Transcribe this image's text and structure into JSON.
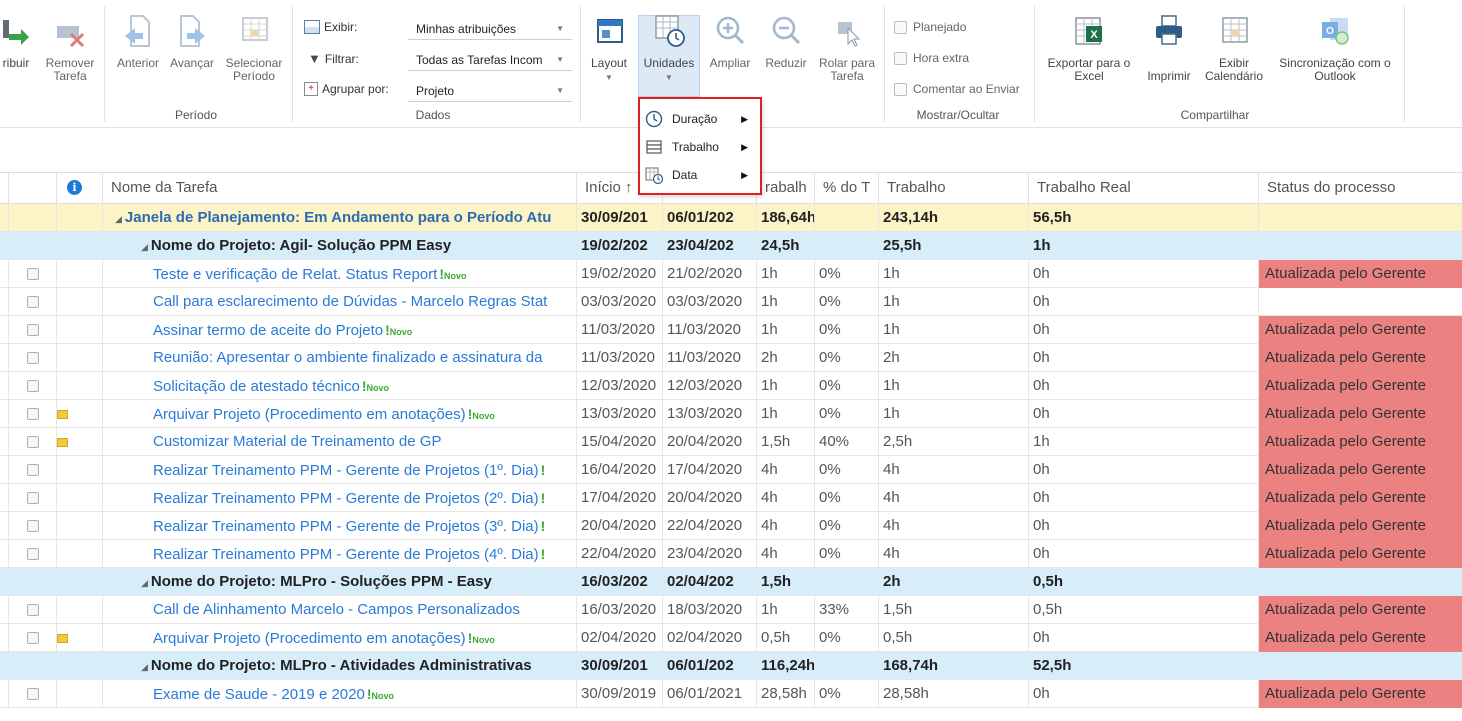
{
  "ribbon": {
    "atribuir": "ribuir",
    "remover": "Remover",
    "remover2": "Tarefa",
    "anterior": "Anterior",
    "avancar": "Avançar",
    "selecionar": "Selecionar",
    "periodo_btn": "Período",
    "group_periodo": "Período",
    "exibir_label": "Exibir:",
    "exibir_value": "Minhas atribuições",
    "filtrar_label": "Filtrar:",
    "filtrar_value": "Todas as Tarefas Incom",
    "agrupar_label": "Agrupar por:",
    "agrupar_value": "Projeto",
    "group_dados": "Dados",
    "layout": "Layout",
    "unidades": "Unidades",
    "ampliar": "Ampliar",
    "reduzir": "Reduzir",
    "rolar": "Rolar para",
    "rolar2": "Tarefa",
    "planejado": "Planejado",
    "hora_extra": "Hora extra",
    "comentar": "Comentar ao Enviar",
    "group_mostrar": "Mostrar/Ocultar",
    "exportar": "Exportar para o",
    "exportar2": "Excel",
    "imprimir": "Imprimir",
    "exibir_cal": "Exibir",
    "exibir_cal2": "Calendário",
    "sincronizacao": "Sincronização com o",
    "sincronizacao2": "Outlook",
    "group_compartilhar": "Compartilhar"
  },
  "menu": {
    "items": [
      {
        "label": "Duração"
      },
      {
        "label": "Trabalho"
      },
      {
        "label": "Data"
      }
    ]
  },
  "columns": {
    "nome": "Nome da Tarefa",
    "inicio": "Início ↑",
    "trabalho_short": "rabalh",
    "pct": "% do T",
    "trabalho": "Trabalho",
    "trabalho_real": "Trabalho Real",
    "status": "Status do processo"
  },
  "rows": [
    {
      "level": 0,
      "name": "Janela de Planejamento: Em Andamento para o Período Atu",
      "inicio": "30/09/201",
      "fim": "06/01/202",
      "trab1": "186,64h",
      "pct": "",
      "trab": "243,14h",
      "real": "56,5h",
      "status": ""
    },
    {
      "level": 1,
      "name": "Nome do Projeto: Agil- Solução PPM Easy",
      "inicio": "19/02/202",
      "fim": "23/04/202",
      "trab1": "24,5h",
      "pct": "",
      "trab": "25,5h",
      "real": "1h",
      "status": ""
    },
    {
      "level": 2,
      "name": "Teste e verificação de Relat. Status Report",
      "novo": true,
      "inicio": "19/02/2020",
      "fim": "21/02/2020",
      "trab1": "1h",
      "pct": "0%",
      "trab": "1h",
      "real": "0h",
      "status": "Atualizada pelo Gerente"
    },
    {
      "level": 2,
      "name": "Call para esclarecimento de Dúvidas - Marcelo Regras Stat",
      "inicio": "03/03/2020",
      "fim": "03/03/2020",
      "trab1": "1h",
      "pct": "0%",
      "trab": "1h",
      "real": "0h",
      "status": ""
    },
    {
      "level": 2,
      "name": "Assinar termo de aceite do Projeto",
      "novo": true,
      "inicio": "11/03/2020",
      "fim": "11/03/2020",
      "trab1": "1h",
      "pct": "0%",
      "trab": "1h",
      "real": "0h",
      "status": "Atualizada pelo Gerente"
    },
    {
      "level": 2,
      "name": "Reunião: Apresentar o ambiente finalizado e assinatura da",
      "inicio": "11/03/2020",
      "fim": "11/03/2020",
      "trab1": "2h",
      "pct": "0%",
      "trab": "2h",
      "real": "0h",
      "status": "Atualizada pelo Gerente"
    },
    {
      "level": 2,
      "name": "Solicitação de atestado técnico",
      "novo": true,
      "inicio": "12/03/2020",
      "fim": "12/03/2020",
      "trab1": "1h",
      "pct": "0%",
      "trab": "1h",
      "real": "0h",
      "status": "Atualizada pelo Gerente"
    },
    {
      "level": 2,
      "name": "Arquivar Projeto (Procedimento em anotações)",
      "novo": true,
      "note": true,
      "inicio": "13/03/2020",
      "fim": "13/03/2020",
      "trab1": "1h",
      "pct": "0%",
      "trab": "1h",
      "real": "0h",
      "status": "Atualizada pelo Gerente"
    },
    {
      "level": 2,
      "name": "Customizar Material de Treinamento de GP",
      "note": true,
      "inicio": "15/04/2020",
      "fim": "20/04/2020",
      "trab1": "1,5h",
      "pct": "40%",
      "trab": "2,5h",
      "real": "1h",
      "status": "Atualizada pelo Gerente"
    },
    {
      "level": 2,
      "name": "Realizar Treinamento PPM - Gerente de Projetos (1º. Dia)",
      "bang": true,
      "inicio": "16/04/2020",
      "fim": "17/04/2020",
      "trab1": "4h",
      "pct": "0%",
      "trab": "4h",
      "real": "0h",
      "status": "Atualizada pelo Gerente"
    },
    {
      "level": 2,
      "name": "Realizar Treinamento PPM - Gerente de Projetos (2º. Dia)",
      "bang": true,
      "inicio": "17/04/2020",
      "fim": "20/04/2020",
      "trab1": "4h",
      "pct": "0%",
      "trab": "4h",
      "real": "0h",
      "status": "Atualizada pelo Gerente"
    },
    {
      "level": 2,
      "name": "Realizar Treinamento PPM - Gerente de Projetos (3º. Dia)",
      "bang": true,
      "inicio": "20/04/2020",
      "fim": "22/04/2020",
      "trab1": "4h",
      "pct": "0%",
      "trab": "4h",
      "real": "0h",
      "status": "Atualizada pelo Gerente"
    },
    {
      "level": 2,
      "name": "Realizar Treinamento PPM - Gerente de Projetos (4º. Dia)",
      "bang": true,
      "inicio": "22/04/2020",
      "fim": "23/04/2020",
      "trab1": "4h",
      "pct": "0%",
      "trab": "4h",
      "real": "0h",
      "status": "Atualizada pelo Gerente"
    },
    {
      "level": 1,
      "name": "Nome do Projeto: MLPro - Soluções PPM - Easy",
      "inicio": "16/03/202",
      "fim": "02/04/202",
      "trab1": "1,5h",
      "pct": "",
      "trab": "2h",
      "real": "0,5h",
      "status": ""
    },
    {
      "level": 2,
      "name": "Call de Alinhamento Marcelo - Campos Personalizados",
      "inicio": "16/03/2020",
      "fim": "18/03/2020",
      "trab1": "1h",
      "pct": "33%",
      "trab": "1,5h",
      "real": "0,5h",
      "status": "Atualizada pelo Gerente"
    },
    {
      "level": 2,
      "name": "Arquivar Projeto (Procedimento em anotações)",
      "novo": true,
      "note": true,
      "inicio": "02/04/2020",
      "fim": "02/04/2020",
      "trab1": "0,5h",
      "pct": "0%",
      "trab": "0,5h",
      "real": "0h",
      "status": "Atualizada pelo Gerente"
    },
    {
      "level": 1,
      "name": "Nome do Projeto: MLPro - Atividades Administrativas",
      "inicio": "30/09/201",
      "fim": "06/01/202",
      "trab1": "116,24h",
      "pct": "",
      "trab": "168,74h",
      "real": "52,5h",
      "status": ""
    },
    {
      "level": 2,
      "name": "Exame de Saude - 2019 e 2020",
      "novo": true,
      "inicio": "30/09/2019",
      "fim": "06/01/2021",
      "trab1": "28,58h",
      "pct": "0%",
      "trab": "28,58h",
      "real": "0h",
      "status": "Atualizada pelo Gerente"
    }
  ],
  "novo_label": "Novo",
  "bang_label": "!",
  "colors": {
    "accent": "#2a7ad8",
    "status_red": "#ec8181",
    "group0": "#fcf3c7",
    "group1": "#d7edf9",
    "menu_border": "#e02020"
  }
}
